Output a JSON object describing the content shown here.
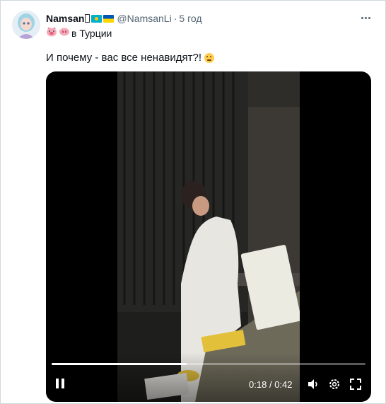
{
  "tweet": {
    "display_name": "Namsan",
    "handle": "@NamsanLi",
    "separator": "·",
    "time": "5 год",
    "line1_text": "в Турции",
    "body_text": "И почему - вас все ненавидят?!",
    "emojis": [
      "pig-face",
      "pig-nose",
      "thinking-face"
    ],
    "flags": [
      "kazakhstan-flag",
      "ukraine-flag"
    ]
  },
  "video": {
    "current_time": "0:18",
    "time_separator": "/",
    "duration": "0:42",
    "progress_fraction": 0.43,
    "controls": [
      "pause-icon",
      "volume-icon",
      "settings-icon",
      "fullscreen-icon"
    ]
  },
  "colors": {
    "text_primary": "#0f1419",
    "text_secondary": "#536471",
    "border": "#cfd9de",
    "video_bg": "#000000"
  }
}
